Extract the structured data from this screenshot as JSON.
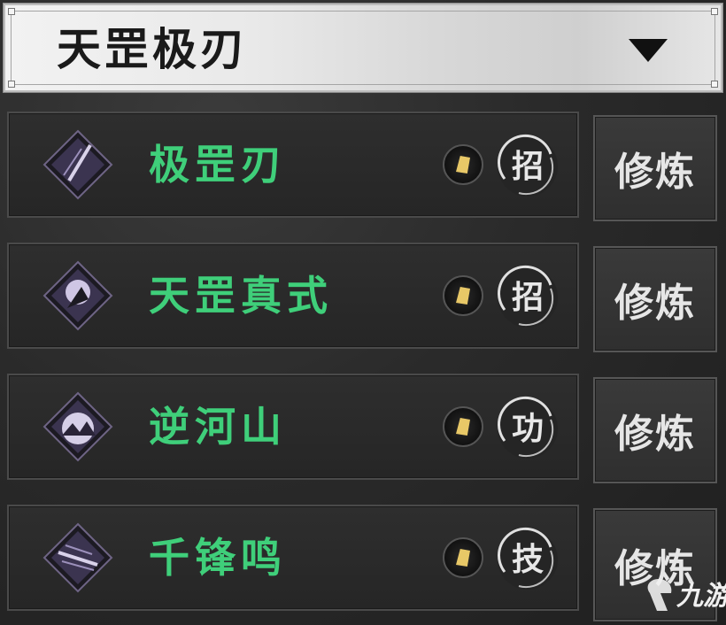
{
  "header": {
    "title": "天罡极刃"
  },
  "skills": [
    {
      "name": "极罡刃",
      "type": "招",
      "icon": "blade-slash-icon"
    },
    {
      "name": "天罡真式",
      "type": "招",
      "icon": "swordsman-strike-icon"
    },
    {
      "name": "逆河山",
      "type": "功",
      "icon": "mountain-river-icon"
    },
    {
      "name": "千锋鸣",
      "type": "技",
      "icon": "thousand-blades-icon"
    }
  ],
  "train_label": "修炼",
  "watermark": {
    "text": "九游"
  },
  "colors": {
    "skill_name": "#3fcf7a",
    "coin": "#e8c867",
    "icon_glow": "#8a7ab0"
  }
}
